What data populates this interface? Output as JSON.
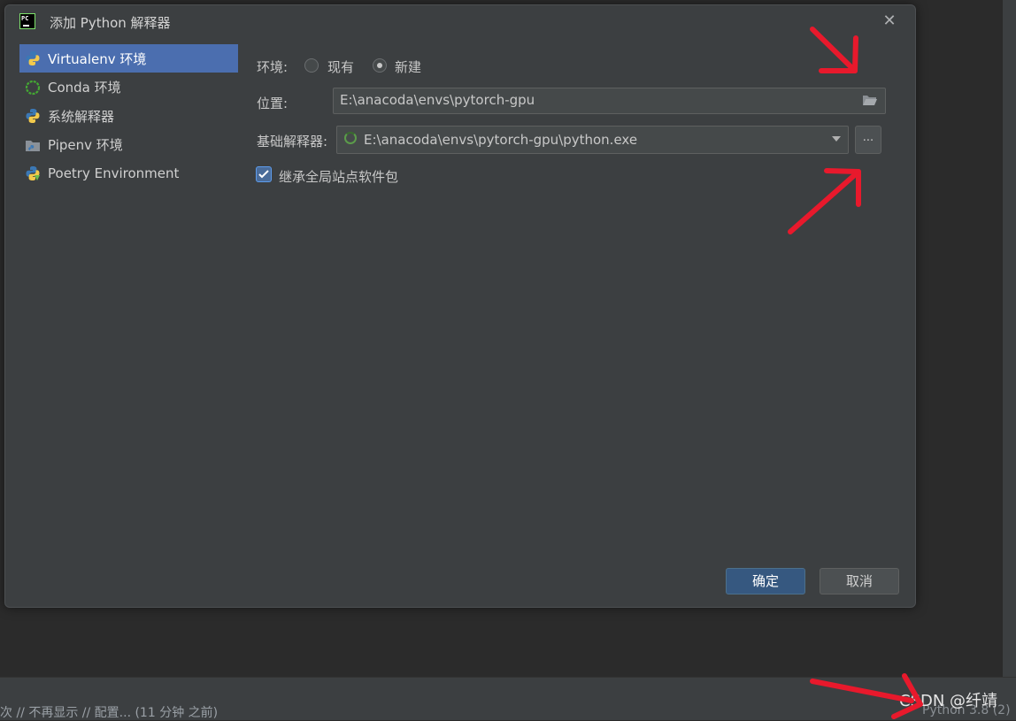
{
  "dialog": {
    "title": "添加 Python 解释器",
    "close_icon": "close-icon"
  },
  "sidebar": {
    "items": [
      {
        "label": "Virtualenv 环境",
        "icon": "python-icon",
        "selected": true
      },
      {
        "label": "Conda 环境",
        "icon": "conda-icon",
        "selected": false
      },
      {
        "label": "系统解释器",
        "icon": "python-icon",
        "selected": false
      },
      {
        "label": "Pipenv 环境",
        "icon": "pipenv-icon",
        "selected": false
      },
      {
        "label": "Poetry Environment",
        "icon": "poetry-icon",
        "selected": false
      }
    ]
  },
  "form": {
    "env_label": "环境:",
    "env_options": [
      {
        "label": "现有",
        "selected": false
      },
      {
        "label": "新建",
        "selected": true
      }
    ],
    "location_label": "位置:",
    "location_value": "E:\\anacoda\\envs\\pytorch-gpu",
    "base_interpreter_label": "基础解释器:",
    "base_interpreter_value": "E:\\anacoda\\envs\\pytorch-gpu\\python.exe",
    "browse_label": "...",
    "inherit_label": "继承全局站点软件包",
    "inherit_checked": true
  },
  "buttons": {
    "ok": "确定",
    "cancel": "取消"
  },
  "statusbar": {
    "message": "次 // 不再显示 // 配置... (11 分钟 之前)",
    "interpreter": "Python 3.8 (2)"
  },
  "watermark": "CSDN @纤靖",
  "colors": {
    "accent": "#4b6eaf",
    "primary_button": "#365880",
    "annotation_arrow": "#e8192c"
  }
}
